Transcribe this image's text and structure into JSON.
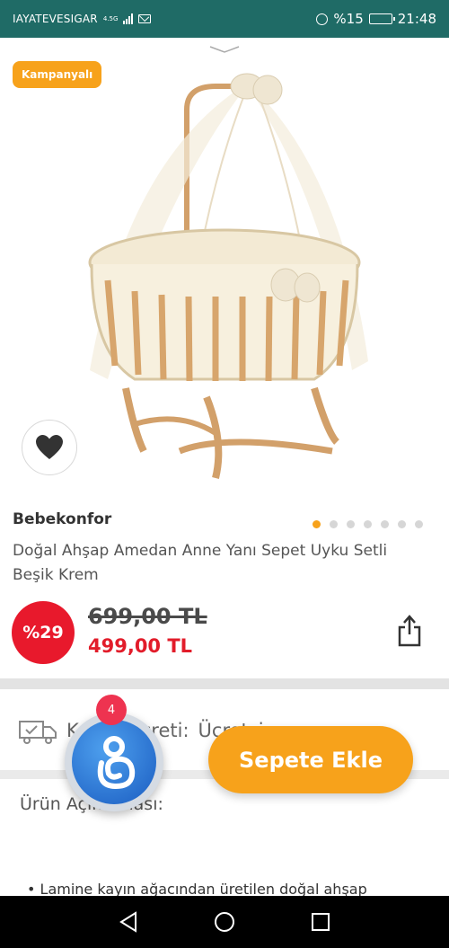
{
  "status_bar": {
    "carrier": "IAYATEVESIGAR",
    "network": "4.5G",
    "battery_percent": "%15",
    "battery_level": 0.15,
    "time": "21:48",
    "icons": [
      "signal-icon",
      "mail-icon",
      "alarm-icon",
      "battery-icon"
    ]
  },
  "product_image": {
    "campaign_label": "Kampanyalı",
    "favorite_icon": "heart-icon",
    "carousel": {
      "total": 7,
      "active_index": 0
    }
  },
  "product": {
    "brand": "Bebekonfor",
    "title_line1": "Doğal Ahşap Amedan Anne Yanı Sepet Uyku Setli",
    "title_line2": "Beşik Krem",
    "discount": "%29",
    "old_price": "699,00 TL",
    "new_price": "499,00 TL",
    "share_icon": "share-icon"
  },
  "shipping": {
    "label": "Kargo Ücreti:",
    "value": "Ücretsiz"
  },
  "description": {
    "label": "Ürün Açıklaması:",
    "bullet": "Lamine kayın ağacından üretilen doğal ahşap"
  },
  "floating": {
    "notification_count": "4",
    "add_to_cart": "Sepete Ekle"
  },
  "colors": {
    "accent": "#f7a21b",
    "discount": "#e8192c",
    "price": "#e21c2a",
    "status_bar": "#1f6b66"
  }
}
